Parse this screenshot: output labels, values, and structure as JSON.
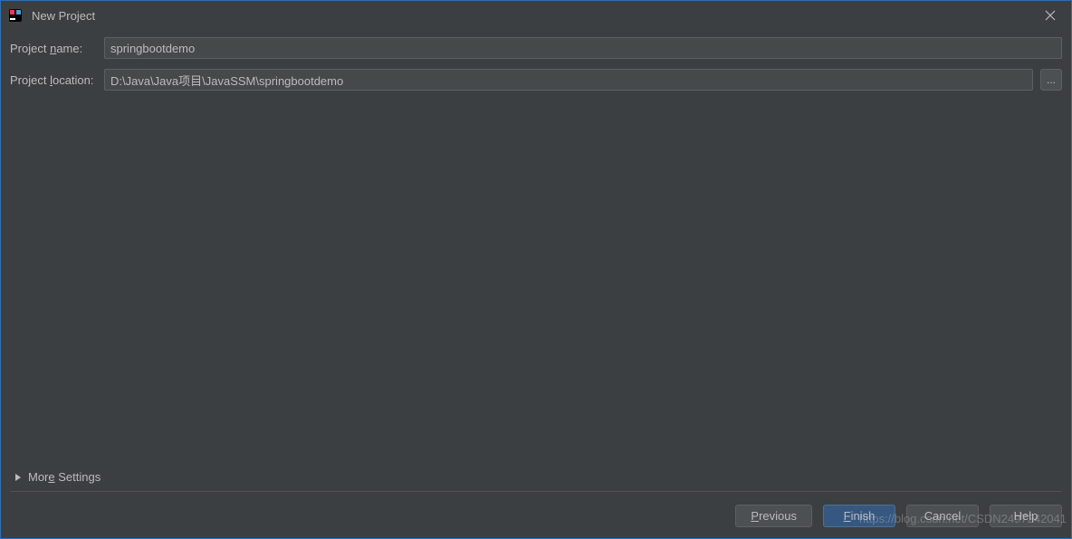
{
  "window": {
    "title": "New Project"
  },
  "form": {
    "projectName": {
      "label_prefix": "Project ",
      "label_underline": "n",
      "label_suffix": "ame:",
      "value": "springbootdemo"
    },
    "projectLocation": {
      "label_prefix": "Project ",
      "label_underline": "l",
      "label_suffix": "ocation:",
      "value": "D:\\Java\\Java项目\\JavaSSM\\springbootdemo",
      "browse": "..."
    }
  },
  "moreSettings": {
    "prefix": "Mor",
    "underline": "e",
    "suffix": " Settings"
  },
  "buttons": {
    "previous": {
      "underline": "P",
      "suffix": "revious"
    },
    "finish": {
      "prefix": "",
      "underline": "F",
      "suffix": "inish"
    },
    "cancel": {
      "text": "Cancel"
    },
    "help": {
      "text": "Help"
    }
  },
  "watermark": "https://blog.csdn.net/CSDN2497242041"
}
